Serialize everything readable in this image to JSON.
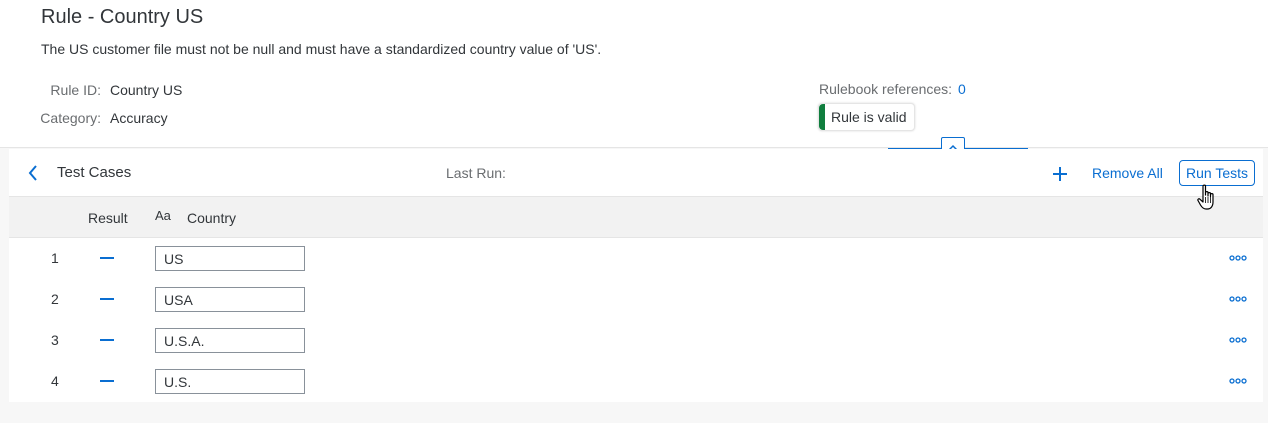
{
  "page": {
    "title": "Rule - Country US",
    "description": "The US customer file must not be null and must have a standardized country value of 'US'."
  },
  "details": {
    "rule_id_label": "Rule ID:",
    "rule_id_value": "Country US",
    "category_label": "Category:",
    "category_value": "Accuracy",
    "rulebook_label": "Rulebook references:",
    "rulebook_value": "0",
    "validity": "Rule is valid"
  },
  "colors": {
    "accent": "#0a6ed1",
    "valid": "#107e3e",
    "text": "#32363a"
  },
  "test_cases": {
    "title": "Test Cases",
    "last_run_label": "Last Run:",
    "remove_all_label": "Remove All",
    "run_tests_label": "Run Tests",
    "columns": {
      "result": "Result",
      "type_icon": "Aa",
      "country": "Country"
    },
    "rows": [
      {
        "num": "1",
        "value": "US"
      },
      {
        "num": "2",
        "value": "USA"
      },
      {
        "num": "3",
        "value": "U.S.A."
      },
      {
        "num": "4",
        "value": "U.S."
      }
    ]
  },
  "icons": {
    "back": "chevron-left-icon",
    "add": "plus-icon",
    "collapse": "chevron-up-icon",
    "more": "overflow-icon",
    "cursor": "hand-cursor-icon"
  }
}
